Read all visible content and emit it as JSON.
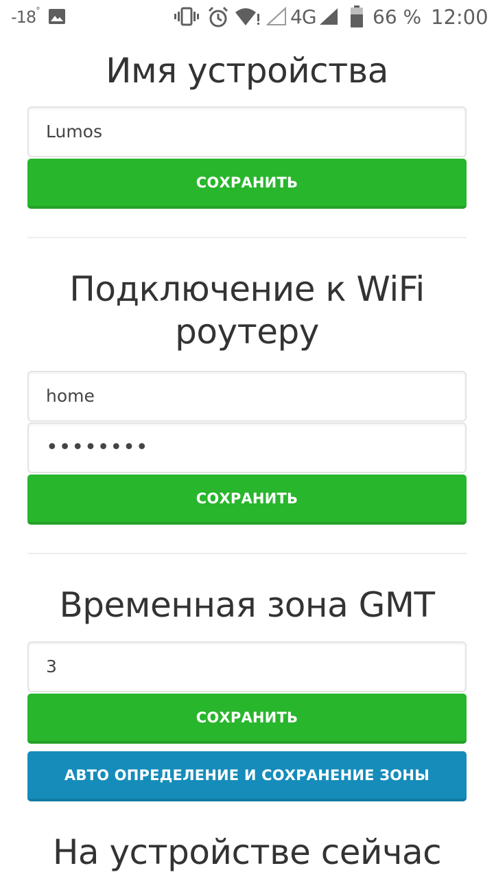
{
  "status_bar": {
    "temperature": "-18",
    "temperature_unit": "°",
    "network": "4G",
    "battery": "66 %",
    "time": "12:00",
    "icons": [
      "image-icon",
      "vibrate-icon",
      "alarm-icon",
      "wifi-icon",
      "signal-icon",
      "signal-icon",
      "battery-icon"
    ]
  },
  "sections": {
    "device_name": {
      "title": "Имя устройства",
      "input_value": "Lumos",
      "save_label": "СОХРАНИТЬ"
    },
    "wifi": {
      "title_line1": "Подключение к WiFi",
      "title_line2": "роутеру",
      "ssid_value": "home",
      "password_value": "••••••••",
      "save_label": "СОХРАНИТЬ"
    },
    "timezone": {
      "title": "Временная зона GMT",
      "input_value": "3",
      "save_label": "СОХРАНИТЬ",
      "auto_label": "АВТО ОПРЕДЕЛЕНИЕ И СОХРАНЕНИЕ ЗОНЫ"
    },
    "device_now": {
      "title": "На устройстве сейчас"
    }
  },
  "colors": {
    "success": "#28b62c",
    "info": "#158cba",
    "text": "#333333"
  }
}
